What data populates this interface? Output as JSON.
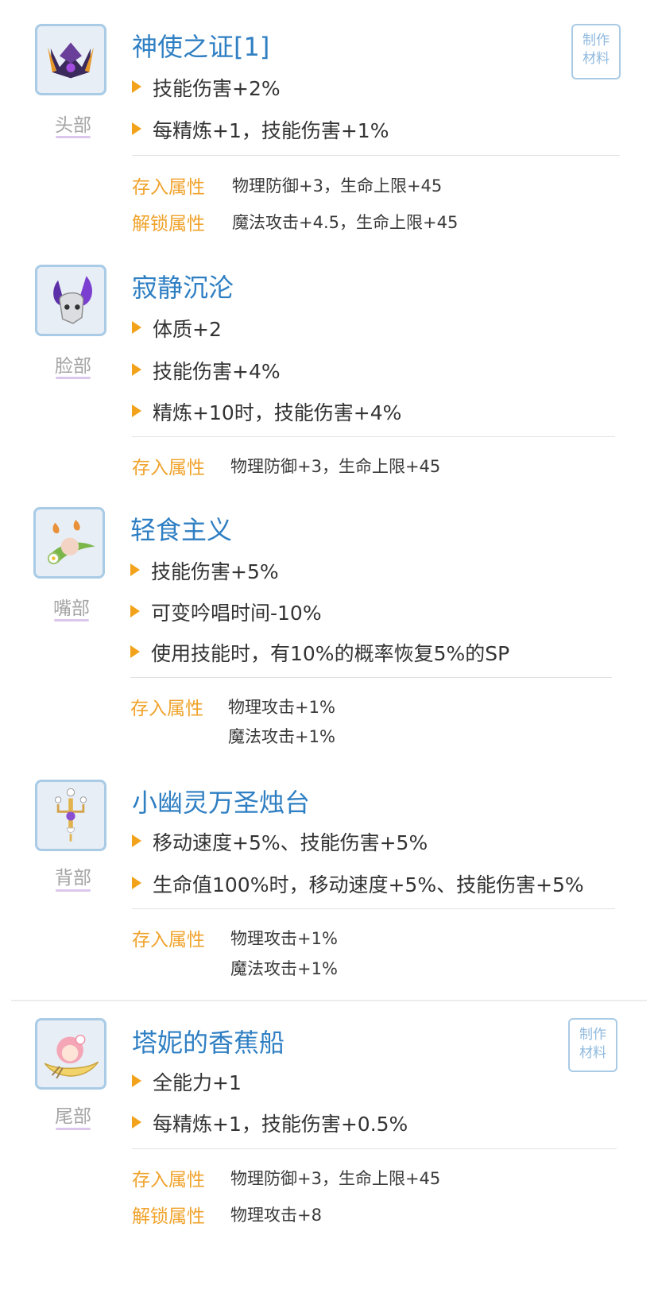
{
  "items": [
    {
      "slot": "头部",
      "icon": "dark-horned-crown-icon",
      "title": "神使之证[1]",
      "effects": [
        "技能伤害+2%",
        "每精炼+1，技能伤害+1%"
      ],
      "craft": {
        "line1": "制作",
        "line2": "材料"
      },
      "stored_label": "存入属性",
      "stored_values": [
        "物理防御+3，生命上限+45"
      ],
      "unlock_label": "解锁属性",
      "unlock_values": [
        "魔法攻击+4.5，生命上限+45"
      ]
    },
    {
      "slot": "脸部",
      "icon": "purple-horn-mask-icon",
      "title": "寂静沉沦",
      "effects": [
        "体质+2",
        "技能伤害+4%",
        "精炼+10时，技能伤害+4%"
      ],
      "stored_label": "存入属性",
      "stored_values": [
        "物理防御+3，生命上限+45"
      ]
    },
    {
      "slot": "嘴部",
      "icon": "flower-leaf-peach-icon",
      "title": "轻食主义",
      "effects": [
        "技能伤害+5%",
        "可变吟唱时间-10%",
        "使用技能时，有10%的概率恢复5%的SP"
      ],
      "stored_label": "存入属性",
      "stored_values": [
        "物理攻击+1%",
        "魔法攻击+1%"
      ]
    },
    {
      "slot": "背部",
      "icon": "ghost-candelabra-icon",
      "title": "小幽灵万圣烛台",
      "effects": [
        "移动速度+5%、技能伤害+5%",
        "生命值100%时，移动速度+5%、技能伤害+5%"
      ],
      "stored_label": "存入属性",
      "stored_values": [
        "物理攻击+1%",
        "魔法攻击+1%"
      ]
    },
    {
      "slot": "尾部",
      "icon": "banana-boat-girl-icon",
      "title": "塔妮的香蕉船",
      "effects": [
        "全能力+1",
        "每精炼+1，技能伤害+0.5%"
      ],
      "craft": {
        "line1": "制作",
        "line2": "材料"
      },
      "stored_label": "存入属性",
      "stored_values": [
        "物理防御+3，生命上限+45"
      ],
      "unlock_label": "解锁属性",
      "unlock_values": [
        "物理攻击+8"
      ]
    }
  ],
  "colors": {
    "title": "#2f7fc3",
    "attr_label": "#f0a32c",
    "bullet": "#f2a31b",
    "thumb_border": "#a9cbe6",
    "slot_underline": "#dcc7ec"
  }
}
